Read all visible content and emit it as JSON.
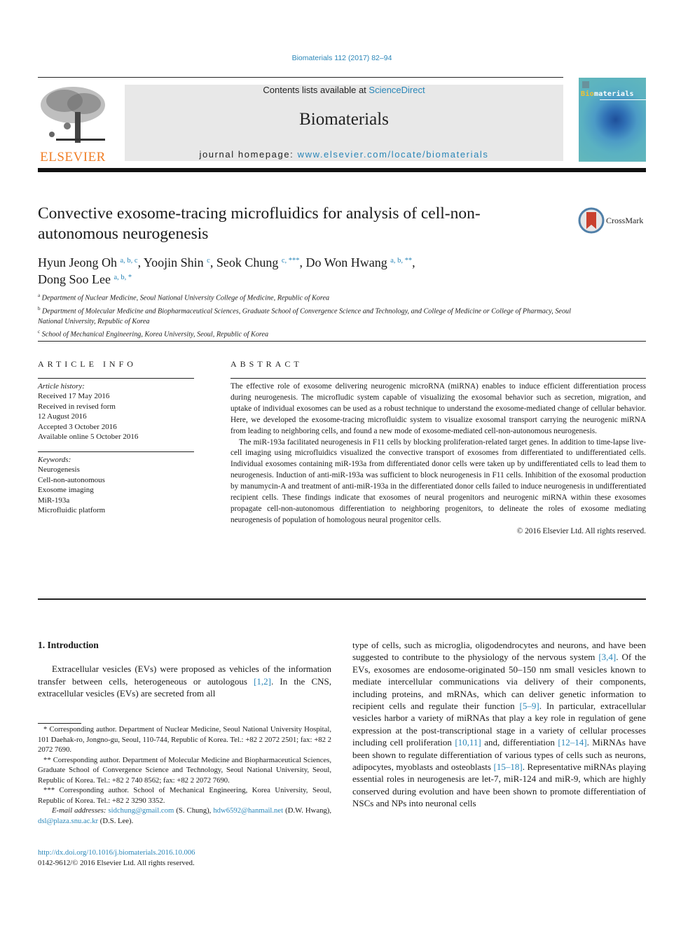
{
  "journal_ref": "Biomaterials 112 (2017) 82–94",
  "header": {
    "contents_prefix": "Contents lists available at ",
    "contents_link": "ScienceDirect",
    "journal_name": "Biomaterials",
    "homepage_prefix": "journal homepage: ",
    "homepage_link": "www.elsevier.com/locate/biomaterials",
    "publisher_logo_text": "ELSEVIER",
    "cover_title_accent": "Bio",
    "cover_title_rest": "materials"
  },
  "article": {
    "title": "Convective exosome-tracing microfluidics for analysis of cell-non-autonomous neurogenesis",
    "crossmark_label": "CrossMark",
    "authors": [
      {
        "name": "Hyun Jeong Oh",
        "sup": "a, b, c",
        "sep": ", "
      },
      {
        "name": "Yoojin Shin",
        "sup": "c",
        "sep": ", "
      },
      {
        "name": "Seok Chung",
        "sup": "c, ***",
        "sep": ", "
      },
      {
        "name": "Do Won Hwang",
        "sup": "a, b, **",
        "sep": ","
      },
      {
        "name": "Dong Soo Lee",
        "sup": "a, b, *",
        "sep": ""
      }
    ],
    "affiliations": [
      {
        "key": "a",
        "text": "Department of Nuclear Medicine, Seoul National University College of Medicine, Republic of Korea"
      },
      {
        "key": "b",
        "text": "Department of Molecular Medicine and Biopharmaceutical Sciences, Graduate School of Convergence Science and Technology, and College of Medicine or College of Pharmacy, Seoul National University, Republic of Korea"
      },
      {
        "key": "c",
        "text": "School of Mechanical Engineering, Korea University, Seoul, Republic of Korea"
      }
    ]
  },
  "article_info": {
    "heading": "ARTICLE INFO",
    "history_label": "Article history:",
    "history": [
      "Received 17 May 2016",
      "Received in revised form",
      "12 August 2016",
      "Accepted 3 October 2016",
      "Available online 5 October 2016"
    ],
    "keywords_label": "Keywords:",
    "keywords": [
      "Neurogenesis",
      "Cell-non-autonomous",
      "Exosome imaging",
      "MiR-193a",
      "Microfluidic platform"
    ]
  },
  "abstract": {
    "heading": "ABSTRACT",
    "paragraphs": [
      "The effective role of exosome delivering neurogenic microRNA (miRNA) enables to induce efficient differentiation process during neurogenesis. The microfludic system capable of visualizing the exosomal behavior such as secretion, migration, and uptake of individual exosomes can be used as a robust technique to understand the exosome-mediated change of cellular behavior. Here, we developed the exosome-tracing microfluidic system to visualize exosomal transport carrying the neurogenic miRNA from leading to neighboring cells, and found a new mode of exosome-mediated cell-non-autonomous neurogenesis.",
      "The miR-193a facilitated neurogenesis in F11 cells by blocking proliferation-related target genes. In addition to time-lapse live-cell imaging using microfluidics visualized the convective transport of exosomes from differentiated to undifferentiated cells. Individual exosomes containing miR-193a from differentiated donor cells were taken up by undifferentiated cells to lead them to neurogenesis. Induction of anti-miR-193a was sufficient to block neurogenesis in F11 cells. Inhibition of the exosomal production by manumycin-A and treatment of anti-miR-193a in the differentiated donor cells failed to induce neurogenesis in undifferentiated recipient cells. These findings indicate that exosomes of neural progenitors and neurogenic miRNA within these exosomes propagate cell-non-autonomous differentiation to neighboring progenitors, to delineate the roles of exosome mediating neurogenesis of population of homologous neural progenitor cells."
    ],
    "copyright": "© 2016 Elsevier Ltd. All rights reserved."
  },
  "introduction": {
    "heading": "1.  Introduction",
    "col1": {
      "text_before": "Extracellular vesicles (EVs) were proposed as vehicles of the information transfer between cells, heterogeneous or autologous ",
      "ref1": "[1,2]",
      "text_after": ". In the CNS, extracellular vesicles (EVs) are secreted from all"
    },
    "col2": [
      {
        "t": "type of cells, such as microglia, oligodendrocytes and neurons, and have been suggested to contribute to the physiology of the nervous system "
      },
      {
        "r": "[3,4]"
      },
      {
        "t": ". Of the EVs, exosomes are endosome-originated 50–150 nm small vesicles known to mediate intercellular communications via delivery of their components, including proteins, and mRNAs, which can deliver genetic information to recipient cells and regulate their function "
      },
      {
        "r": "[5–9]"
      },
      {
        "t": ". In particular, extracellular vesicles harbor a variety of miRNAs that play a key role in regulation of gene expression at the post-transcriptional stage in a variety of cellular processes including cell proliferation "
      },
      {
        "r": "[10,11]"
      },
      {
        "t": " and, differentiation "
      },
      {
        "r": "[12–14]"
      },
      {
        "t": ". MiRNAs have been shown to regulate differentiation of various types of cells such as neurons, adipocytes, myoblasts and osteoblasts "
      },
      {
        "r": "[15–18]"
      },
      {
        "t": ". Representative miRNAs playing essential roles in neurogenesis are let-7, miR-124 and miR-9, which are highly conserved during evolution and have been shown to promote differentiation of NSCs and NPs into neuronal cells"
      }
    ]
  },
  "footnotes": {
    "fn1": "* Corresponding author. Department of Nuclear Medicine, Seoul National University Hospital, 101 Daehak-ro, Jongno-gu, Seoul, 110-744, Republic of Korea. Tel.: +82 2 2072 2501; fax: +82 2 2072 7690.",
    "fn2": "** Corresponding author. Department of Molecular Medicine and Biopharmaceutical Sciences, Graduate School of Convergence Science and Technology, Seoul National University, Seoul, Republic of Korea. Tel.: +82 2 740 8562; fax: +82 2 2072 7690.",
    "fn3": "*** Corresponding author. School of Mechanical Engineering, Korea University, Seoul, Republic of Korea. Tel.: +82 2 3290 3352.",
    "email_label": "E-mail addresses: ",
    "emails": [
      {
        "addr": "sidchung@gmail.com",
        "who": " (S. Chung), "
      },
      {
        "addr": "hdw6592@hanmail.net",
        "who": " (D.W. Hwang), "
      },
      {
        "addr": "dsl@plaza.snu.ac.kr",
        "who": " (D.S. Lee)."
      }
    ]
  },
  "doi": {
    "url": "http://dx.doi.org/10.1016/j.biomaterials.2016.10.006",
    "issn_line": "0142-9612/© 2016 Elsevier Ltd. All rights reserved."
  },
  "colors": {
    "link": "#2a86b8",
    "elsevier_orange": "#f07e26",
    "header_band": "#e8e8e8"
  }
}
